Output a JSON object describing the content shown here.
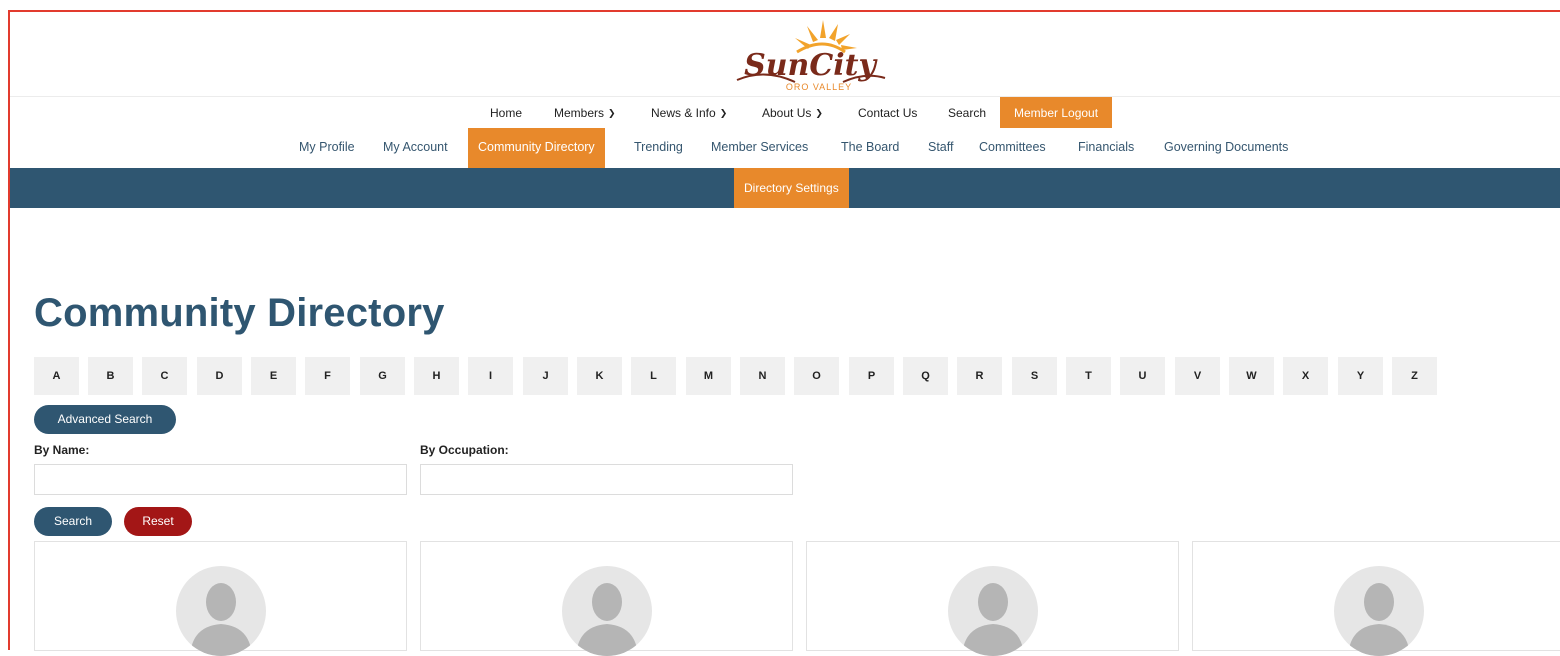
{
  "logo": {
    "brand": "SunCity",
    "tagline": "ORO VALLEY",
    "colors": {
      "sun": "#f2a32b",
      "text": "#7a2a1a",
      "tagline": "#e8892b"
    }
  },
  "main_nav": {
    "items": [
      {
        "label": "Home",
        "dropdown": false
      },
      {
        "label": "Members",
        "dropdown": true
      },
      {
        "label": "News & Info",
        "dropdown": true
      },
      {
        "label": "About Us",
        "dropdown": true
      },
      {
        "label": "Contact Us",
        "dropdown": false
      },
      {
        "label": "Search",
        "dropdown": false
      }
    ],
    "logout_label": "Member Logout",
    "chevron_icon": "chevron-down-icon"
  },
  "sub_nav": {
    "items": [
      "My Profile",
      "My Account",
      "Community Directory",
      "Trending",
      "Member Services",
      "The Board",
      "Staff",
      "Committees",
      "Financials",
      "Governing Documents"
    ],
    "active": "Community Directory"
  },
  "settings_tab": "Directory Settings",
  "page": {
    "title": "Community Directory",
    "letters": [
      "A",
      "B",
      "C",
      "D",
      "E",
      "F",
      "G",
      "H",
      "I",
      "J",
      "K",
      "L",
      "M",
      "N",
      "O",
      "P",
      "Q",
      "R",
      "S",
      "T",
      "U",
      "V",
      "W",
      "X",
      "Y",
      "Z"
    ],
    "advanced_search_label": "Advanced Search",
    "by_name_label": "By Name:",
    "by_name_value": "",
    "by_occupation_label": "By Occupation:",
    "by_occupation_value": "",
    "search_label": "Search",
    "reset_label": "Reset"
  },
  "cards": [
    {
      "avatar_icon": "person-placeholder-icon"
    },
    {
      "avatar_icon": "person-placeholder-icon"
    },
    {
      "avatar_icon": "person-placeholder-icon"
    },
    {
      "avatar_icon": "person-placeholder-icon"
    }
  ],
  "colors": {
    "accent_orange": "#e8892b",
    "navy": "#2f5671",
    "reset_red": "#a31616",
    "letter_bg": "#f0f0f0"
  }
}
